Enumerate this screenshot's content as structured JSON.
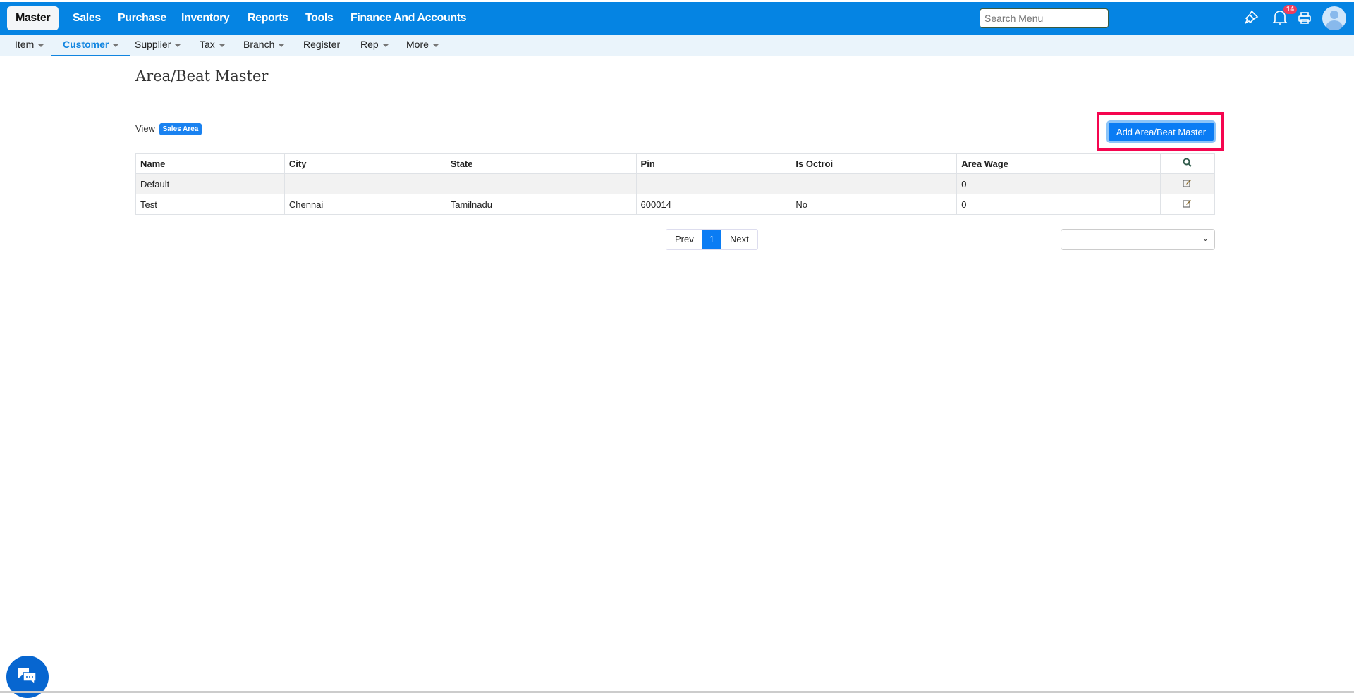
{
  "topnav": {
    "items": [
      "Master",
      "Sales",
      "Purchase",
      "Inventory",
      "Reports",
      "Tools",
      "Finance And Accounts"
    ],
    "active": "Master"
  },
  "search": {
    "placeholder": "Search Menu"
  },
  "notifications": {
    "count": "14"
  },
  "subnav": {
    "items": [
      "Item",
      "Customer",
      "Supplier",
      "Tax",
      "Branch",
      "Register",
      "Rep",
      "More"
    ],
    "active": "Customer"
  },
  "page": {
    "title": "Area/Beat Master",
    "view_label": "View",
    "view_badge": "Sales Area",
    "add_button": "Add Area/Beat Master"
  },
  "table": {
    "headers": [
      "Name",
      "City",
      "State",
      "Pin",
      "Is Octroi",
      "Area Wage"
    ],
    "rows": [
      [
        "Default",
        "",
        "",
        "",
        "",
        "0"
      ],
      [
        "Test",
        "Chennai",
        "Tamilnadu",
        "600014",
        "No",
        "0"
      ]
    ]
  },
  "pagination": {
    "prev": "Prev",
    "current": "1",
    "next": "Next"
  },
  "colors": {
    "brand": "#0584e3",
    "highlight": "#f5054f"
  }
}
